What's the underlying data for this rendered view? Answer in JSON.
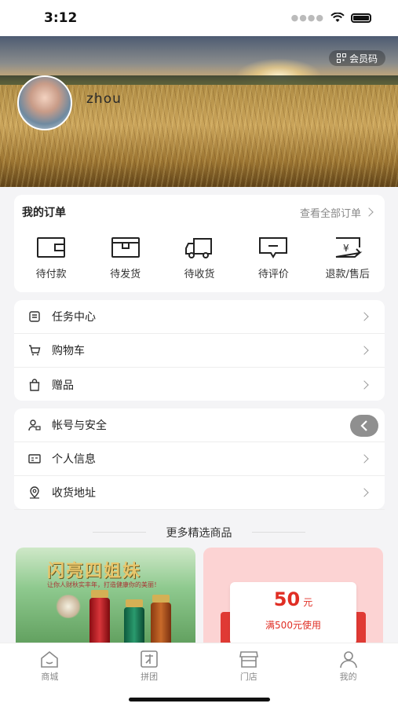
{
  "status_bar": {
    "time": "3:12"
  },
  "hero": {
    "member_badge": "会员码",
    "username": "zhou"
  },
  "orders": {
    "title": "我的订单",
    "view_all": "查看全部订单",
    "items": [
      {
        "label": "待付款",
        "icon": "wallet-icon"
      },
      {
        "label": "待发货",
        "icon": "package-icon"
      },
      {
        "label": "待收货",
        "icon": "truck-icon"
      },
      {
        "label": "待评价",
        "icon": "comment-icon"
      },
      {
        "label": "退款/售后",
        "icon": "refund-icon"
      }
    ]
  },
  "menu_group_1": [
    {
      "label": "任务中心",
      "icon": "task-icon"
    },
    {
      "label": "购物车",
      "icon": "cart-icon"
    },
    {
      "label": "赠品",
      "icon": "gift-bag-icon"
    }
  ],
  "menu_group_2": [
    {
      "label": "帐号与安全",
      "icon": "user-lock-icon"
    },
    {
      "label": "个人信息",
      "icon": "id-card-icon"
    },
    {
      "label": "收货地址",
      "icon": "location-icon"
    }
  ],
  "more_goods": {
    "title": "更多精选商品",
    "product_1": {
      "title": "闪亮四姐妹",
      "subtitle": "让你人财秋实丰年，打造健康你的美丽！"
    },
    "product_2": {
      "amount": "50",
      "unit": "元",
      "condition": "满500元使用"
    }
  },
  "tab_bar": {
    "tabs": [
      {
        "label": "商城",
        "icon": "home-icon",
        "active": false
      },
      {
        "label": "拼团",
        "icon": "group-buy-icon",
        "active": false
      },
      {
        "label": "门店",
        "icon": "store-icon",
        "active": false
      },
      {
        "label": "我的",
        "icon": "profile-icon",
        "active": true
      }
    ]
  },
  "colors": {
    "accent_red": "#e02e24",
    "background": "#f4f4f6",
    "card": "#ffffff"
  }
}
